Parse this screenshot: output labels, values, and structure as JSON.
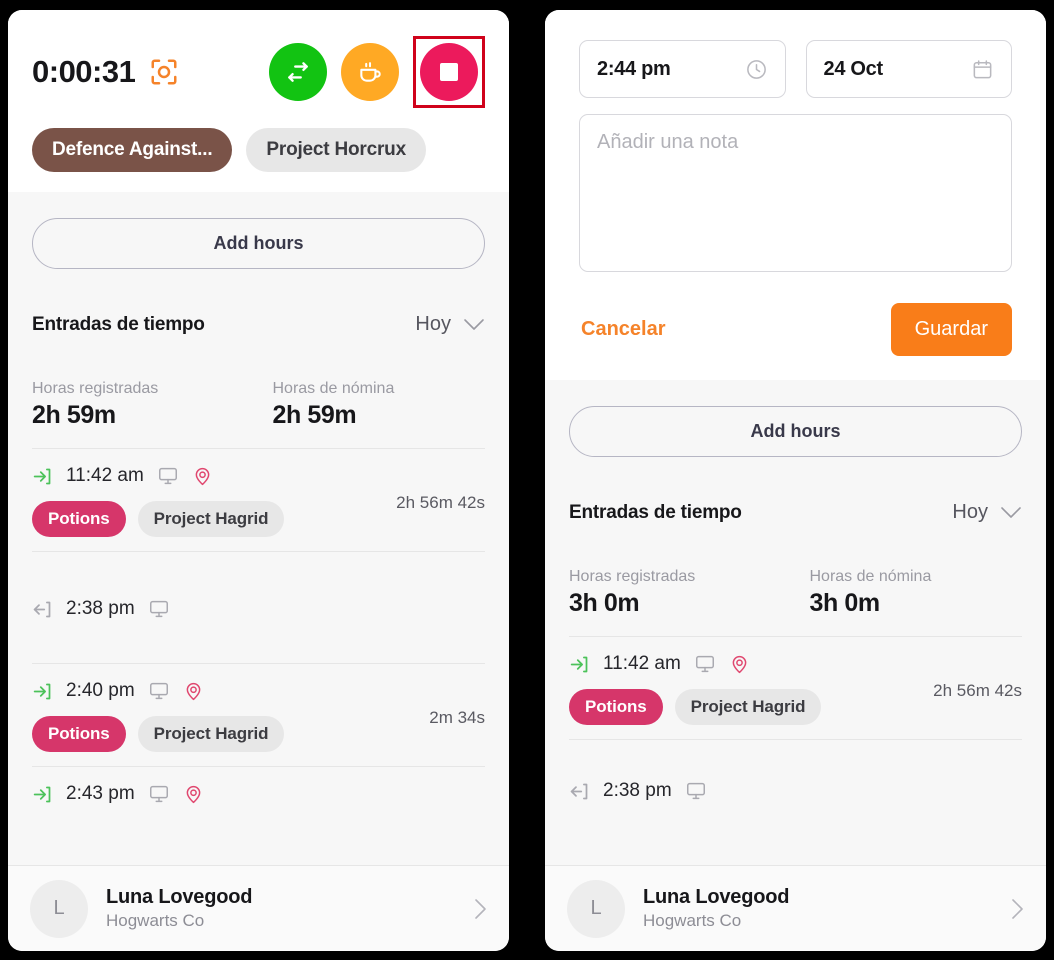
{
  "left_panel": {
    "timer": {
      "value": "0:00:31",
      "capture_icon": "capture-frame-icon",
      "buttons": [
        {
          "name": "switch-task-button",
          "icon": "switch-arrows-icon",
          "color": "#12c312"
        },
        {
          "name": "break-button",
          "icon": "coffee-cup-icon",
          "color": "#ffa924"
        },
        {
          "name": "stop-button",
          "icon": "stop-square-icon",
          "color": "#ec1a5c",
          "highlight_color": "#d0021b"
        }
      ],
      "task_pill": "Defence Against...",
      "project_pill": "Project Horcrux"
    },
    "add_hours_label": "Add hours",
    "section": {
      "title": "Entradas de tiempo",
      "filter_label": "Hoy",
      "chevron_icon": "chevron-down-icon"
    },
    "totals": {
      "logged_label": "Horas registradas",
      "logged_value": "2h 59m",
      "payroll_label": "Horas de nómina",
      "payroll_value": "2h 59m"
    },
    "entries": [
      {
        "direction": "in",
        "direction_icon": "arrow-enter-icon",
        "time": "11:42 am",
        "device_icon": "monitor-icon",
        "location_icon": "location-pin-icon",
        "duration": "2h 56m 42s",
        "category": "Potions",
        "project": "Project Hagrid"
      },
      {
        "direction": "out",
        "direction_icon": "arrow-exit-icon",
        "time": "2:38 pm",
        "device_icon": "monitor-icon",
        "location_icon": null,
        "duration": "",
        "category": null,
        "project": null
      },
      {
        "direction": "in",
        "direction_icon": "arrow-enter-icon",
        "time": "2:40 pm",
        "device_icon": "monitor-icon",
        "location_icon": "location-pin-icon",
        "duration": "2m 34s",
        "category": "Potions",
        "project": "Project Hagrid"
      }
    ],
    "user": {
      "initial": "L",
      "name": "Luna Lovegood",
      "org": "Hogwarts Co",
      "chevron_icon": "chevron-right-icon"
    }
  },
  "right_panel": {
    "form": {
      "time_value": "2:44 pm",
      "time_icon": "clock-icon",
      "date_value": "24 Oct",
      "date_icon": "calendar-icon",
      "note_placeholder": "Añadir una nota",
      "note_value": "",
      "cancel_label": "Cancelar",
      "save_label": "Guardar",
      "save_color": "#f97d19",
      "cancel_color": "#f5832a"
    },
    "add_hours_label": "Add hours",
    "section": {
      "title": "Entradas de tiempo",
      "filter_label": "Hoy",
      "chevron_icon": "chevron-down-icon"
    },
    "totals": {
      "logged_label": "Horas registradas",
      "logged_value": "3h 0m",
      "payroll_label": "Horas de nómina",
      "payroll_value": "3h 0m"
    },
    "entries": [
      {
        "direction": "in",
        "direction_icon": "arrow-enter-icon",
        "time": "11:42 am",
        "device_icon": "monitor-icon",
        "location_icon": "location-pin-icon",
        "duration": "2h 56m 42s",
        "category": "Potions",
        "project": "Project Hagrid"
      },
      {
        "direction": "out",
        "direction_icon": "arrow-exit-icon",
        "time": "2:38 pm",
        "device_icon": "monitor-icon",
        "location_icon": null,
        "duration": "",
        "category": null,
        "project": null
      }
    ],
    "user": {
      "initial": "L",
      "name": "Luna Lovegood",
      "org": "Hogwarts Co",
      "chevron_icon": "chevron-right-icon"
    }
  },
  "colors": {
    "brand_orange": "#f97d19",
    "category_pink": "#d6366a",
    "task_brown": "#7a5348",
    "stop_pink": "#ec1a5c",
    "highlight_red": "#d0021b",
    "green": "#12c312",
    "amber": "#ffa924",
    "panel_bg": "#f7f7f7"
  }
}
